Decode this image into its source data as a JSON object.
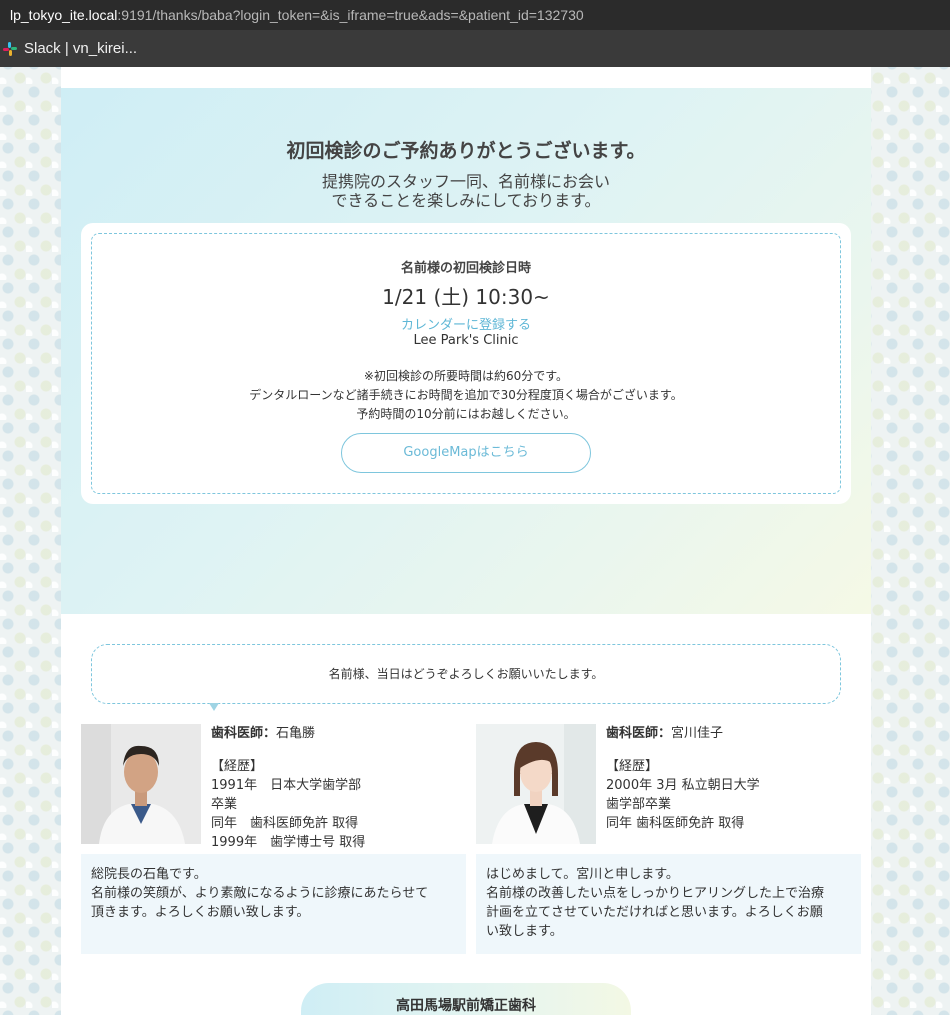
{
  "browser": {
    "url_host": "lp_tokyo_ite.local",
    "url_rest": ":9191/thanks/baba?login_token=&is_iframe=true&ads=&patient_id=132730",
    "bookmark_label": "Slack | vn_kirei..."
  },
  "hero": {
    "title": "初回検診のご予約ありがとうございます。",
    "subtitle_line1": "提携院のスタッフ一同、名前様にお会い",
    "subtitle_line2": "できることを楽しみにしております。"
  },
  "appointment": {
    "label": "名前様の初回検診日時",
    "datetime": "1/21 (土) 10:30~",
    "calendar_link": "カレンダーに登録する",
    "clinic": "Lee Park's Clinic",
    "note1": "※初回検診の所要時間は約60分です。",
    "note2": "デンタルローンなど諸手続きにお時間を追加で30分程度頂く場合がございます。",
    "note3": "予約時間の10分前にはお越しください。",
    "map_button": "GoogleMapはこちら"
  },
  "greeting": "名前様、当日はどうぞよろしくお願いいたします。",
  "doctors": [
    {
      "role": "歯科医師：",
      "name": "石亀勝",
      "history_label": "【経歴】",
      "history": [
        "1991年　日本大学歯学部",
        "卒業",
        "同年　歯科医師免許  取得",
        "1999年　歯学博士号  取得"
      ],
      "message_lines": [
        "総院長の石亀です。",
        "名前様の笑顔が、より素敵になるように診療にあたらせて",
        "頂きます。よろしくお願い致します。"
      ]
    },
    {
      "role": "歯科医師：",
      "name": "宮川佳子",
      "history_label": "【経歴】",
      "history": [
        "2000年 3月 私立朝日大学",
        "歯学部卒業",
        "同年 歯科医師免許 取得"
      ],
      "message_lines": [
        "はじめまして。宮川と申します。",
        "名前様の改善したい点をしっかりヒアリングした上で治療",
        "計画を立てさせていただければと思います。よろしくお願",
        "い致します。"
      ]
    }
  ],
  "clinic_footer": "高田馬場駅前矯正歯科",
  "colors": {
    "accent": "#5fb7d6",
    "dashed_border": "#7ec6dd",
    "message_bg": "#eff7fb"
  }
}
